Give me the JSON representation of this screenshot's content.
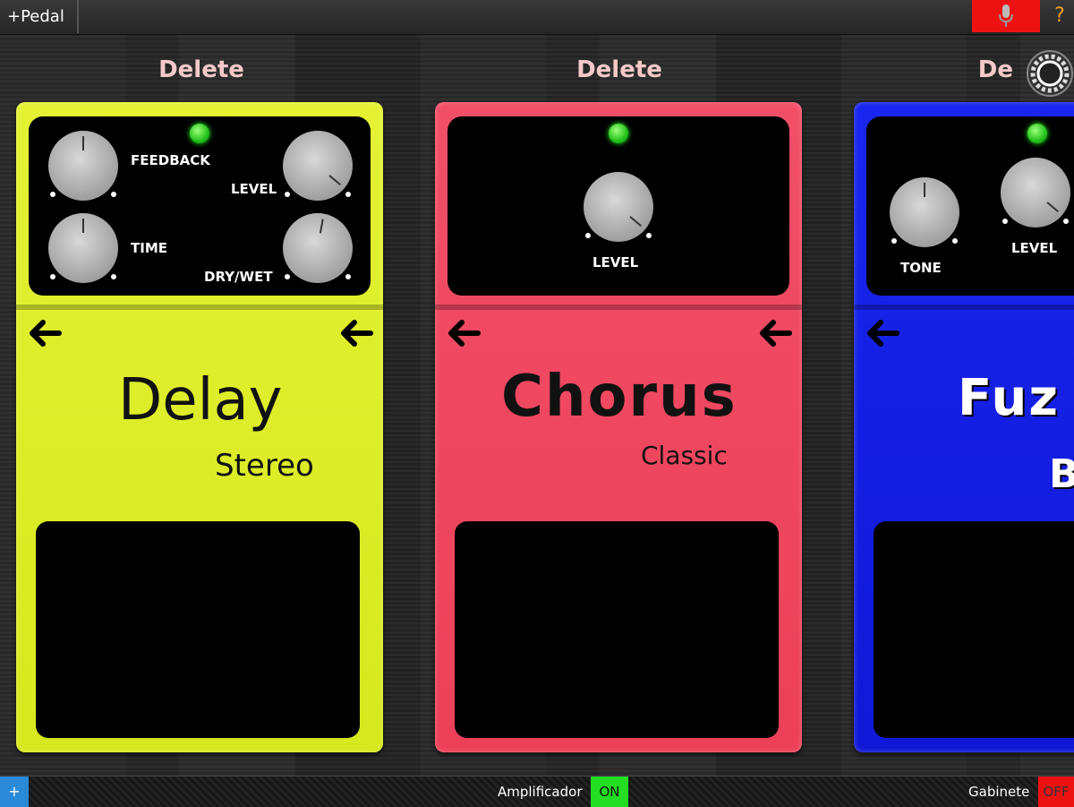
{
  "topbar": {
    "add_pedal_label": "+Pedal",
    "mic_icon": "microphone-icon",
    "help_label": "?"
  },
  "colors": {
    "delay": "#dcee22",
    "chorus": "#f04660",
    "fuzz": "#1420e6",
    "led": "#23c21a",
    "mic_bg": "#ee1111",
    "on": "#22dd22",
    "off": "#ee1111"
  },
  "pedals": [
    {
      "delete_label": "Delete",
      "name": "Delay",
      "variant": "Stereo",
      "knobs": [
        {
          "label": "FEEDBACK",
          "level": 0.5
        },
        {
          "label": "LEVEL",
          "level": 0.85
        },
        {
          "label": "TIME",
          "level": 0.5
        },
        {
          "label": "DRY/WET",
          "level": 0.55
        }
      ]
    },
    {
      "delete_label": "Delete",
      "name": "Chorus",
      "variant": "Classic",
      "knobs": [
        {
          "label": "LEVEL",
          "level": 0.85
        }
      ]
    },
    {
      "delete_label": "De",
      "name": "Fuz",
      "variant": "B",
      "knobs": [
        {
          "label": "TONE",
          "level": 0.5
        },
        {
          "label": "LEVEL",
          "level": 0.85
        }
      ]
    }
  ],
  "bottombar": {
    "plus_label": "+",
    "amp_label": "Amplificador",
    "amp_state": "ON",
    "cab_label": "Gabinete",
    "cab_state": "OFF"
  }
}
